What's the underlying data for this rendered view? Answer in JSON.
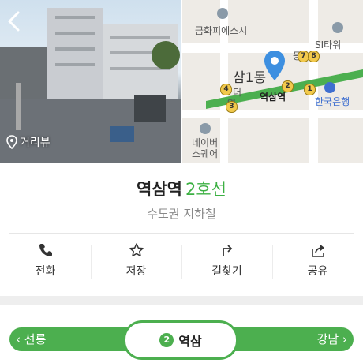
{
  "roadview": {
    "label": "거리뷰"
  },
  "map": {
    "labels": {
      "bldg1": "금화피에스시",
      "si_tower": "SI타워",
      "samil_dong": "삼1동",
      "station": "역삼역",
      "bank": "한국은행",
      "naver": "네이버",
      "square": "스퀘어",
      "de": "더",
      "yeok": "역",
      "song": "송",
      "deung": "등"
    },
    "exits": [
      "7",
      "8",
      "4",
      "2",
      "1",
      "3"
    ],
    "colors": {
      "line": "#4caf4f",
      "pin": "#3d8fe0"
    }
  },
  "station": {
    "name": "역삼역",
    "line": "2호선",
    "category": "수도권 지하철"
  },
  "actions": [
    {
      "label": "전화",
      "icon": "phone-icon"
    },
    {
      "label": "저장",
      "icon": "star-icon"
    },
    {
      "label": "길찾기",
      "icon": "directions-icon"
    },
    {
      "label": "공유",
      "icon": "share-icon"
    }
  ],
  "line_nav": {
    "prev": "선릉",
    "current": "역삼",
    "line_number": "2",
    "next": "강남",
    "color": "#4caf4f"
  }
}
